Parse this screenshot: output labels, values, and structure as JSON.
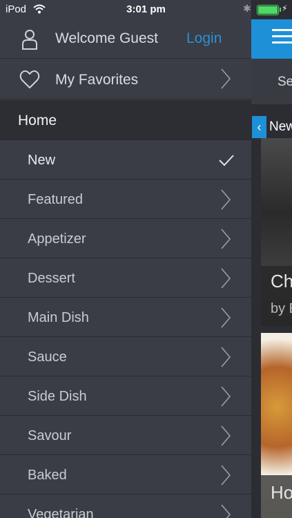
{
  "status_bar": {
    "carrier": "iPod",
    "time": "3:01 pm"
  },
  "drawer": {
    "welcome_text": "Welcome Guest",
    "login_label": "Login",
    "favorites_label": "My Favorites",
    "home_label": "Home",
    "categories": [
      {
        "label": "New",
        "selected": true
      },
      {
        "label": "Featured",
        "selected": false
      },
      {
        "label": "Appetizer",
        "selected": false
      },
      {
        "label": "Dessert",
        "selected": false
      },
      {
        "label": "Main Dish",
        "selected": false
      },
      {
        "label": "Sauce",
        "selected": false
      },
      {
        "label": "Side Dish",
        "selected": false
      },
      {
        "label": "Savour",
        "selected": false
      },
      {
        "label": "Baked",
        "selected": false
      },
      {
        "label": "Vegetarian",
        "selected": false
      }
    ]
  },
  "main": {
    "tab_partial": "Se",
    "section_partial": "New",
    "card1_title_partial": "Ch",
    "card1_author_partial": "by E",
    "card2_title_partial": "Ho"
  },
  "colors": {
    "accent": "#1e90d8",
    "login_link": "#2d8fd5",
    "drawer_bg": "#3a3d45",
    "home_row_bg": "#2c2e34",
    "battery": "#4cd964"
  }
}
